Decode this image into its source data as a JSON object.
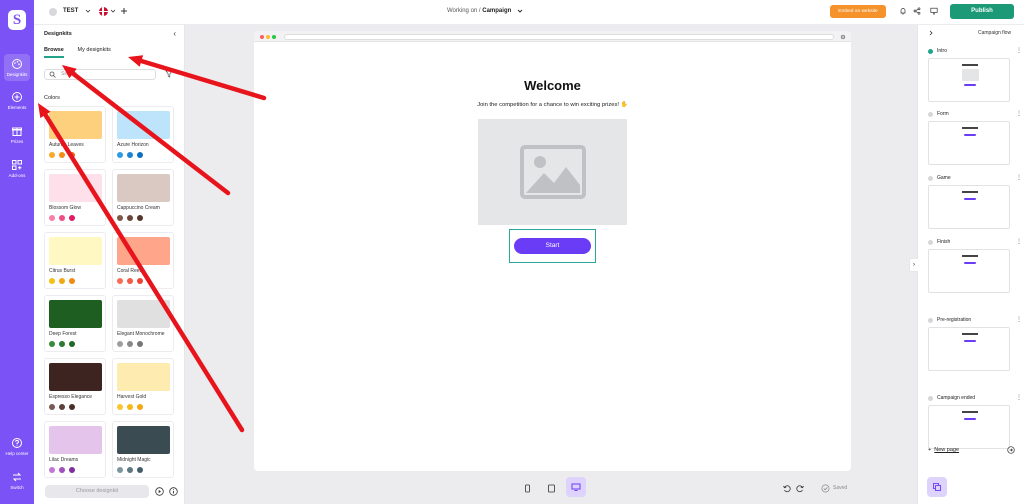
{
  "topbar": {
    "project_name": "TEST",
    "working_on_prefix": "Working on",
    "working_on_separator": "/",
    "working_on_page": "Campaign",
    "embed_label": "Embed on website",
    "publish_label": "Publish",
    "accent": "#1c9a78",
    "embed_color": "#f5922b"
  },
  "rail": {
    "brand_color": "#7b52f5",
    "logo_letter": "S",
    "items": [
      {
        "label": "Designkits",
        "icon": "palette-icon"
      },
      {
        "label": "Elements",
        "icon": "plus-circle-icon"
      },
      {
        "label": "Prizes",
        "icon": "gift-icon"
      },
      {
        "label": "Add-ons",
        "icon": "grid-plus-icon"
      },
      {
        "label": "Help center",
        "icon": "help-icon"
      },
      {
        "label": "Switch",
        "icon": "swap-icon"
      }
    ]
  },
  "designkits": {
    "title": "Designkits",
    "tabs": [
      "Browse",
      "My designkits"
    ],
    "search_placeholder": "Search",
    "section_label": "Colors",
    "choose_label": "Choose designkit",
    "kits": [
      {
        "name": "Autumn Leaves",
        "swatch": "#fdd07e",
        "dots": [
          "#f7a928",
          "#f38b16",
          "#e86414"
        ]
      },
      {
        "name": "Azure Horizon",
        "swatch": "#bde4fb",
        "dots": [
          "#2f9be0",
          "#1c84d0",
          "#0f6fc0"
        ]
      },
      {
        "name": "Blossom Glow",
        "swatch": "#fde0ea",
        "dots": [
          "#f77fa8",
          "#f04d85",
          "#e01a63"
        ]
      },
      {
        "name": "Cappuccino Cream",
        "swatch": "#dac9c2",
        "dots": [
          "#7d5747",
          "#6a4537",
          "#56362a"
        ]
      },
      {
        "name": "Citrus Burst",
        "swatch": "#fff8c2",
        "dots": [
          "#f6c112",
          "#f3a712",
          "#ef8a12"
        ]
      },
      {
        "name": "Coral Reef",
        "swatch": "#fea58a",
        "dots": [
          "#f76d55",
          "#f45a46",
          "#ec4436"
        ]
      },
      {
        "name": "Deep Forest",
        "swatch": "#1f5e21",
        "dots": [
          "#3a8a3c",
          "#2e7a31",
          "#206a25"
        ]
      },
      {
        "name": "Elegant Monochrome",
        "swatch": "#e0e0e0",
        "dots": [
          "#9e9e9e",
          "#8a8a8a",
          "#767676"
        ]
      },
      {
        "name": "Espresso Elegance",
        "swatch": "#3d2420",
        "dots": [
          "#7a5a52",
          "#5e4038",
          "#4a2e28"
        ]
      },
      {
        "name": "Harvest Gold",
        "swatch": "#fdebb0",
        "dots": [
          "#f9c530",
          "#f7b81c",
          "#f3a712"
        ]
      },
      {
        "name": "Lilac Dreams",
        "swatch": "#e4c4ea",
        "dots": [
          "#c078d4",
          "#a050bd",
          "#7f2ea1"
        ]
      },
      {
        "name": "Midnight Magic",
        "swatch": "#3a4b52",
        "dots": [
          "#7c96a0",
          "#5c7882",
          "#425e68"
        ]
      }
    ]
  },
  "canvas": {
    "heading": "Welcome",
    "subline": "Join the competition for a chance to win exciting prizes! ✋",
    "start_label": "Start",
    "saved_label": "Saved",
    "button_color": "#6b3cf6"
  },
  "flow": {
    "title": "Campaign flow",
    "steps": [
      {
        "name": "Intro",
        "active": true
      },
      {
        "name": "Form",
        "active": false
      },
      {
        "name": "Game",
        "active": false
      },
      {
        "name": "Finish",
        "active": false
      },
      {
        "name": "Pre-registration",
        "active": false
      },
      {
        "name": "Campaign ended",
        "active": false
      }
    ],
    "new_page_label": "New page"
  },
  "annotations": {
    "arrow_color": "#e8141c"
  }
}
